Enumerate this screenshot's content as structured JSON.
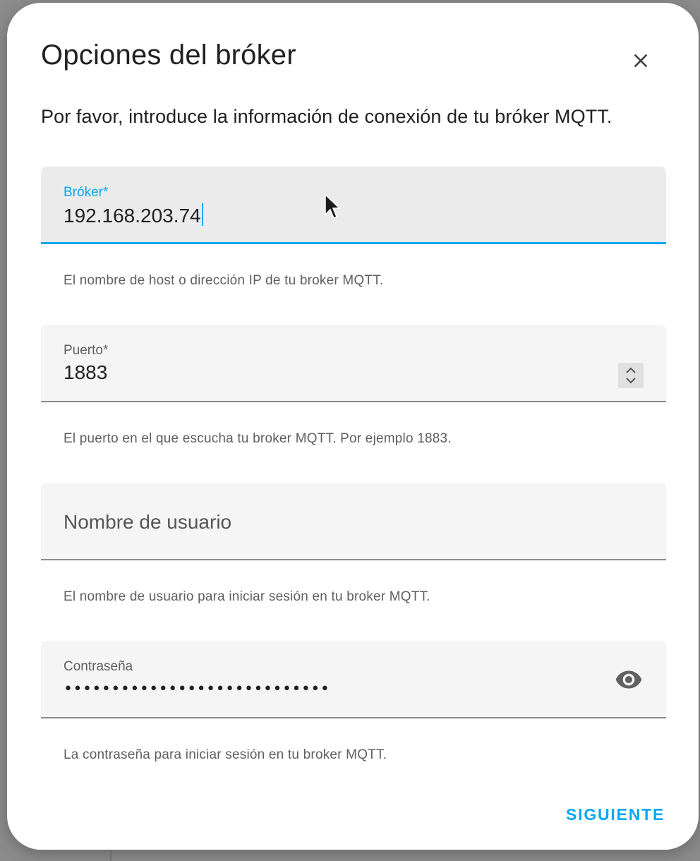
{
  "dialog": {
    "title": "Opciones del bróker",
    "description": "Por favor, introduce la información de conexión de tu bróker MQTT.",
    "close_icon": "close-icon",
    "next_label": "SIGUIENTE"
  },
  "fields": {
    "broker": {
      "label": "Bróker*",
      "value": "192.168.203.74",
      "helper": "El nombre de host o dirección IP de tu broker MQTT.",
      "focused": true
    },
    "port": {
      "label": "Puerto*",
      "value": "1883",
      "helper": "El puerto en el que escucha tu broker MQTT. Por ejemplo 1883.",
      "icon": "spinner-icon"
    },
    "username": {
      "label": "Nombre de usuario",
      "value": "",
      "helper": "El nombre de usuario para iniciar sesión en tu broker MQTT."
    },
    "password": {
      "label": "Contraseña",
      "value": "••••••••••••••••••••••••••••",
      "helper": "La contraseña para iniciar sesión en tu broker MQTT.",
      "icon": "eye-icon"
    }
  },
  "colors": {
    "accent": "#03a9f4",
    "text_primary": "#212121",
    "text_secondary": "#5f5f5f",
    "field_bg": "#f5f5f5"
  }
}
